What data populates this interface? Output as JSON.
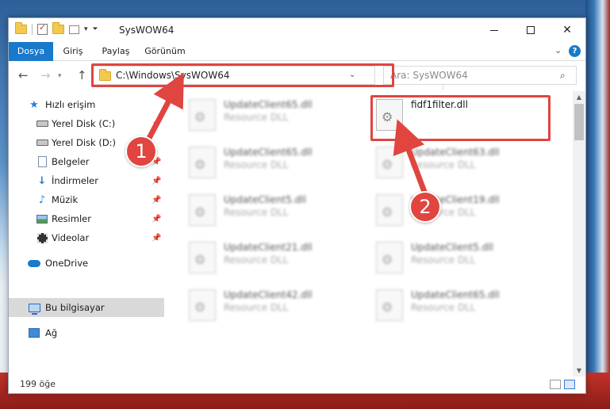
{
  "window": {
    "title": "SysWOW64"
  },
  "ribbon": {
    "tabs": [
      "Dosya",
      "Giriş",
      "Paylaş",
      "Görünüm"
    ],
    "help": "?"
  },
  "address": {
    "path": "C:\\Windows\\SysWOW64"
  },
  "search": {
    "placeholder": "Ara: SysWOW64"
  },
  "sidebar": {
    "items": [
      {
        "label": "Hızlı erişim",
        "icon": "star-icon"
      },
      {
        "label": "Yerel Disk (C:)",
        "icon": "drive-c-icon"
      },
      {
        "label": "Yerel Disk (D:)",
        "icon": "drive-d-icon"
      },
      {
        "label": "Belgeler",
        "icon": "documents-icon"
      },
      {
        "label": "İndirmeler",
        "icon": "downloads-icon"
      },
      {
        "label": "Müzik",
        "icon": "music-icon"
      },
      {
        "label": "Resimler",
        "icon": "pictures-icon"
      },
      {
        "label": "Videolar",
        "icon": "videos-icon"
      },
      {
        "label": "OneDrive",
        "icon": "onedrive-icon"
      },
      {
        "label": "Bu bilgisayar",
        "icon": "this-pc-icon",
        "selected": true
      },
      {
        "label": "Ağ",
        "icon": "network-icon"
      }
    ]
  },
  "status": {
    "count": "199 öğe"
  },
  "files": {
    "left": [
      {
        "name": "UpdateClient65.dll",
        "type": "Resource DLL"
      },
      {
        "name": "UpdateClient65.dll",
        "type": "Resource DLL"
      },
      {
        "name": "UpdateClient5.dll",
        "type": "Resource DLL"
      },
      {
        "name": "UpdateClient21.dll",
        "type": "Resource DLL"
      },
      {
        "name": "UpdateClient42.dll",
        "type": "Resource DLL"
      }
    ],
    "right": [
      {
        "name": "fidf1filter.dll",
        "type": ""
      },
      {
        "name": "UpdateClient63.dll",
        "type": "Resource DLL"
      },
      {
        "name": "UpdateClient19.dll",
        "type": "Resource DLL"
      },
      {
        "name": "UpdateClient5.dll",
        "type": "Resource DLL"
      },
      {
        "name": "UpdateClient65.dll",
        "type": "Resource DLL"
      }
    ]
  },
  "annotations": {
    "step1": "1",
    "step2": "2",
    "color": "#e0453f"
  }
}
